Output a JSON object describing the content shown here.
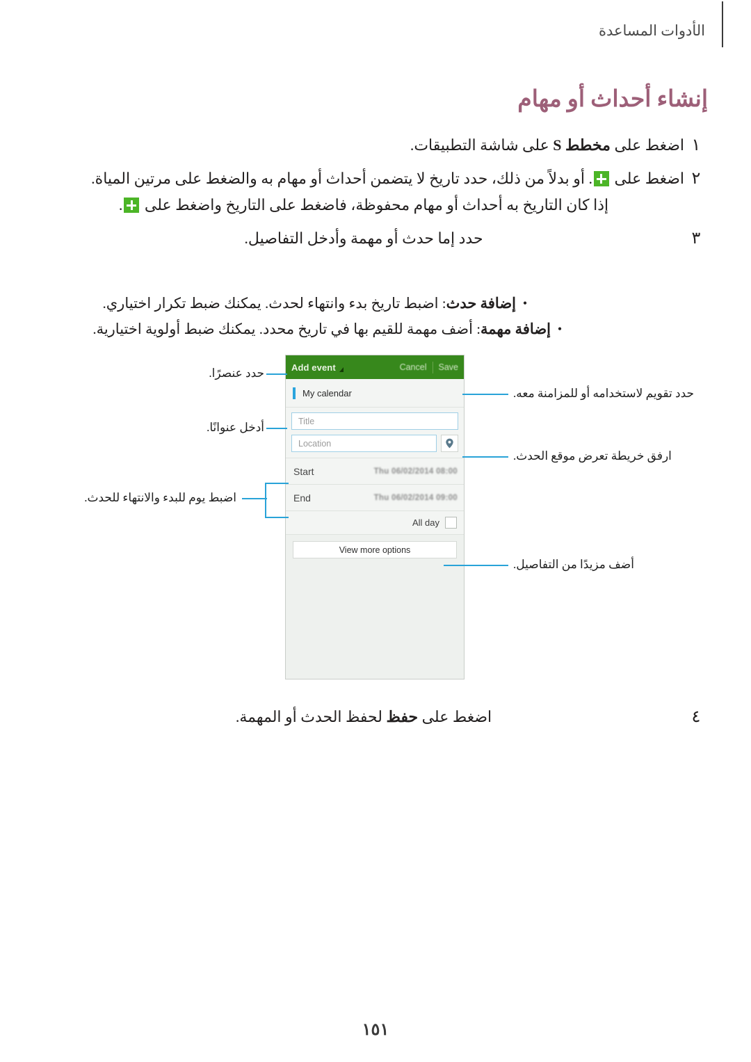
{
  "header": {
    "running_title": "الأدوات المساعدة"
  },
  "section": {
    "title": "إنشاء أحداث أو مهام"
  },
  "steps": [
    {
      "number": "١",
      "lines": [
        {
          "parts": [
            {
              "text": "اضغط على ",
              "bold": false
            },
            {
              "text": "مخطط S",
              "bold": true
            },
            {
              "text": " على شاشة التطبيقات.",
              "bold": false
            }
          ]
        }
      ]
    },
    {
      "number": "٢",
      "lines": [
        {
          "parts": [
            {
              "text": "اضغط على ",
              "bold": false
            },
            {
              "text": "[plus]",
              "bold": false
            },
            {
              "text": ". أو بدلاً من ذلك، حدد تاريخ لا يتضمن أحداث أو مهام به والضغط على مرتين المياة.",
              "bold": false
            }
          ]
        },
        {
          "parts": [
            {
              "text": "إذا كان التاريخ به أحداث أو مهام محفوظة، فاضغط على التاريخ واضغط على ",
              "bold": false
            },
            {
              "text": "[plus]",
              "bold": false
            },
            {
              "text": ".",
              "bold": false
            }
          ]
        }
      ]
    },
    {
      "number": "٣",
      "lines": [
        {
          "parts": [
            {
              "text": "حدد إما حدث أو مهمة وأدخل التفاصيل.",
              "bold": false
            }
          ]
        }
      ]
    }
  ],
  "bullets": [
    {
      "dot": "•",
      "label": "إضافة حدث",
      "separator": ": ",
      "text": "اضبط تاريخ بدء وانتهاء لحدث. يمكنك ضبط تكرار اختياري."
    },
    {
      "dot": "•",
      "label": "إضافة مهمة",
      "separator": ": ",
      "text": "أضف مهمة للقيم بها في تاريخ محدد. يمكنك ضبط أولوية اختيارية."
    }
  ],
  "figure": {
    "phone": {
      "action_bar": {
        "title": "Add event",
        "cancel": "Cancel",
        "save": "Save"
      },
      "calendar_row": {
        "name": "My calendar",
        "swatch_color": "#2aa4dd"
      },
      "title_field": {
        "placeholder": "Title",
        "value": ""
      },
      "location_field": {
        "placeholder": "Location",
        "value": ""
      },
      "start_row": {
        "label": "Start",
        "value": "Thu 06/02/2014   08:00"
      },
      "end_row": {
        "label": "End",
        "value": "Thu 06/02/2014   09:00"
      },
      "all_day": {
        "label": "All day",
        "checked": false
      },
      "more_options": {
        "label": "View more options"
      }
    },
    "callouts": {
      "select_item": "حدد عنصرًا.",
      "enter_title": "أدخل عنوانًا.",
      "set_start_end": "اضبط يوم للبدء والانتهاء للحدث.",
      "select_calendar": "حدد تقويم لاستخدامه أو للمزامنة معه.",
      "attach_map": "ارفق خريطة تعرض موقع الحدث.",
      "add_details": "أضف مزيدًا من التفاصيل."
    }
  },
  "final_step": {
    "number": "٤",
    "parts": [
      {
        "text": "اضغط على ",
        "bold": false
      },
      {
        "text": "حفظ",
        "bold": true
      },
      {
        "text": " لحفظ الحدث أو المهمة.",
        "bold": false
      }
    ]
  },
  "page_number": "١٥١",
  "colors": {
    "title": "#9d5f78",
    "accent_green": "#37881c",
    "plus_green": "#4cb527",
    "leader_blue": "#29a3d8"
  }
}
